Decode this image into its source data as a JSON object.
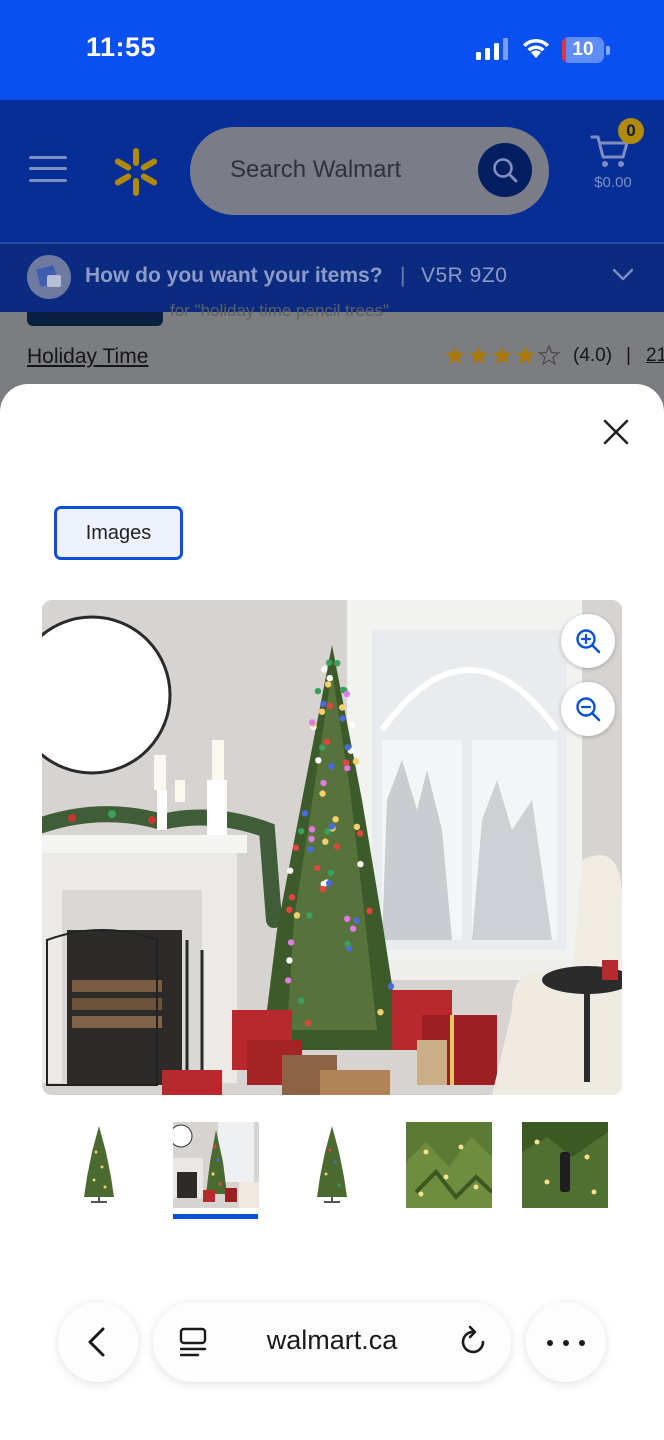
{
  "status_bar": {
    "time": "11:55",
    "battery_level": "10",
    "battery_fraction": 0.1
  },
  "header": {
    "search_placeholder": "Search Walmart",
    "cart_count": "0",
    "cart_total": "$0.00",
    "brand_color": "#0a4ff0",
    "spark_color": "#b08a08"
  },
  "delivery": {
    "prompt": "How do you want your items?",
    "separator": "|",
    "postal_code": "V5R 9Z0"
  },
  "product": {
    "faded_text": "for \"holiday time pencil trees\"",
    "brand": "Holiday Time",
    "rating_value": 4.0,
    "rating_text": "(4.0)",
    "rating_separator": "|",
    "review_count": "21"
  },
  "modal": {
    "tab_label": "Images",
    "selected_thumbnail": 2,
    "accent_color": "#0b51d6"
  },
  "browser": {
    "url": "walmart.ca"
  }
}
